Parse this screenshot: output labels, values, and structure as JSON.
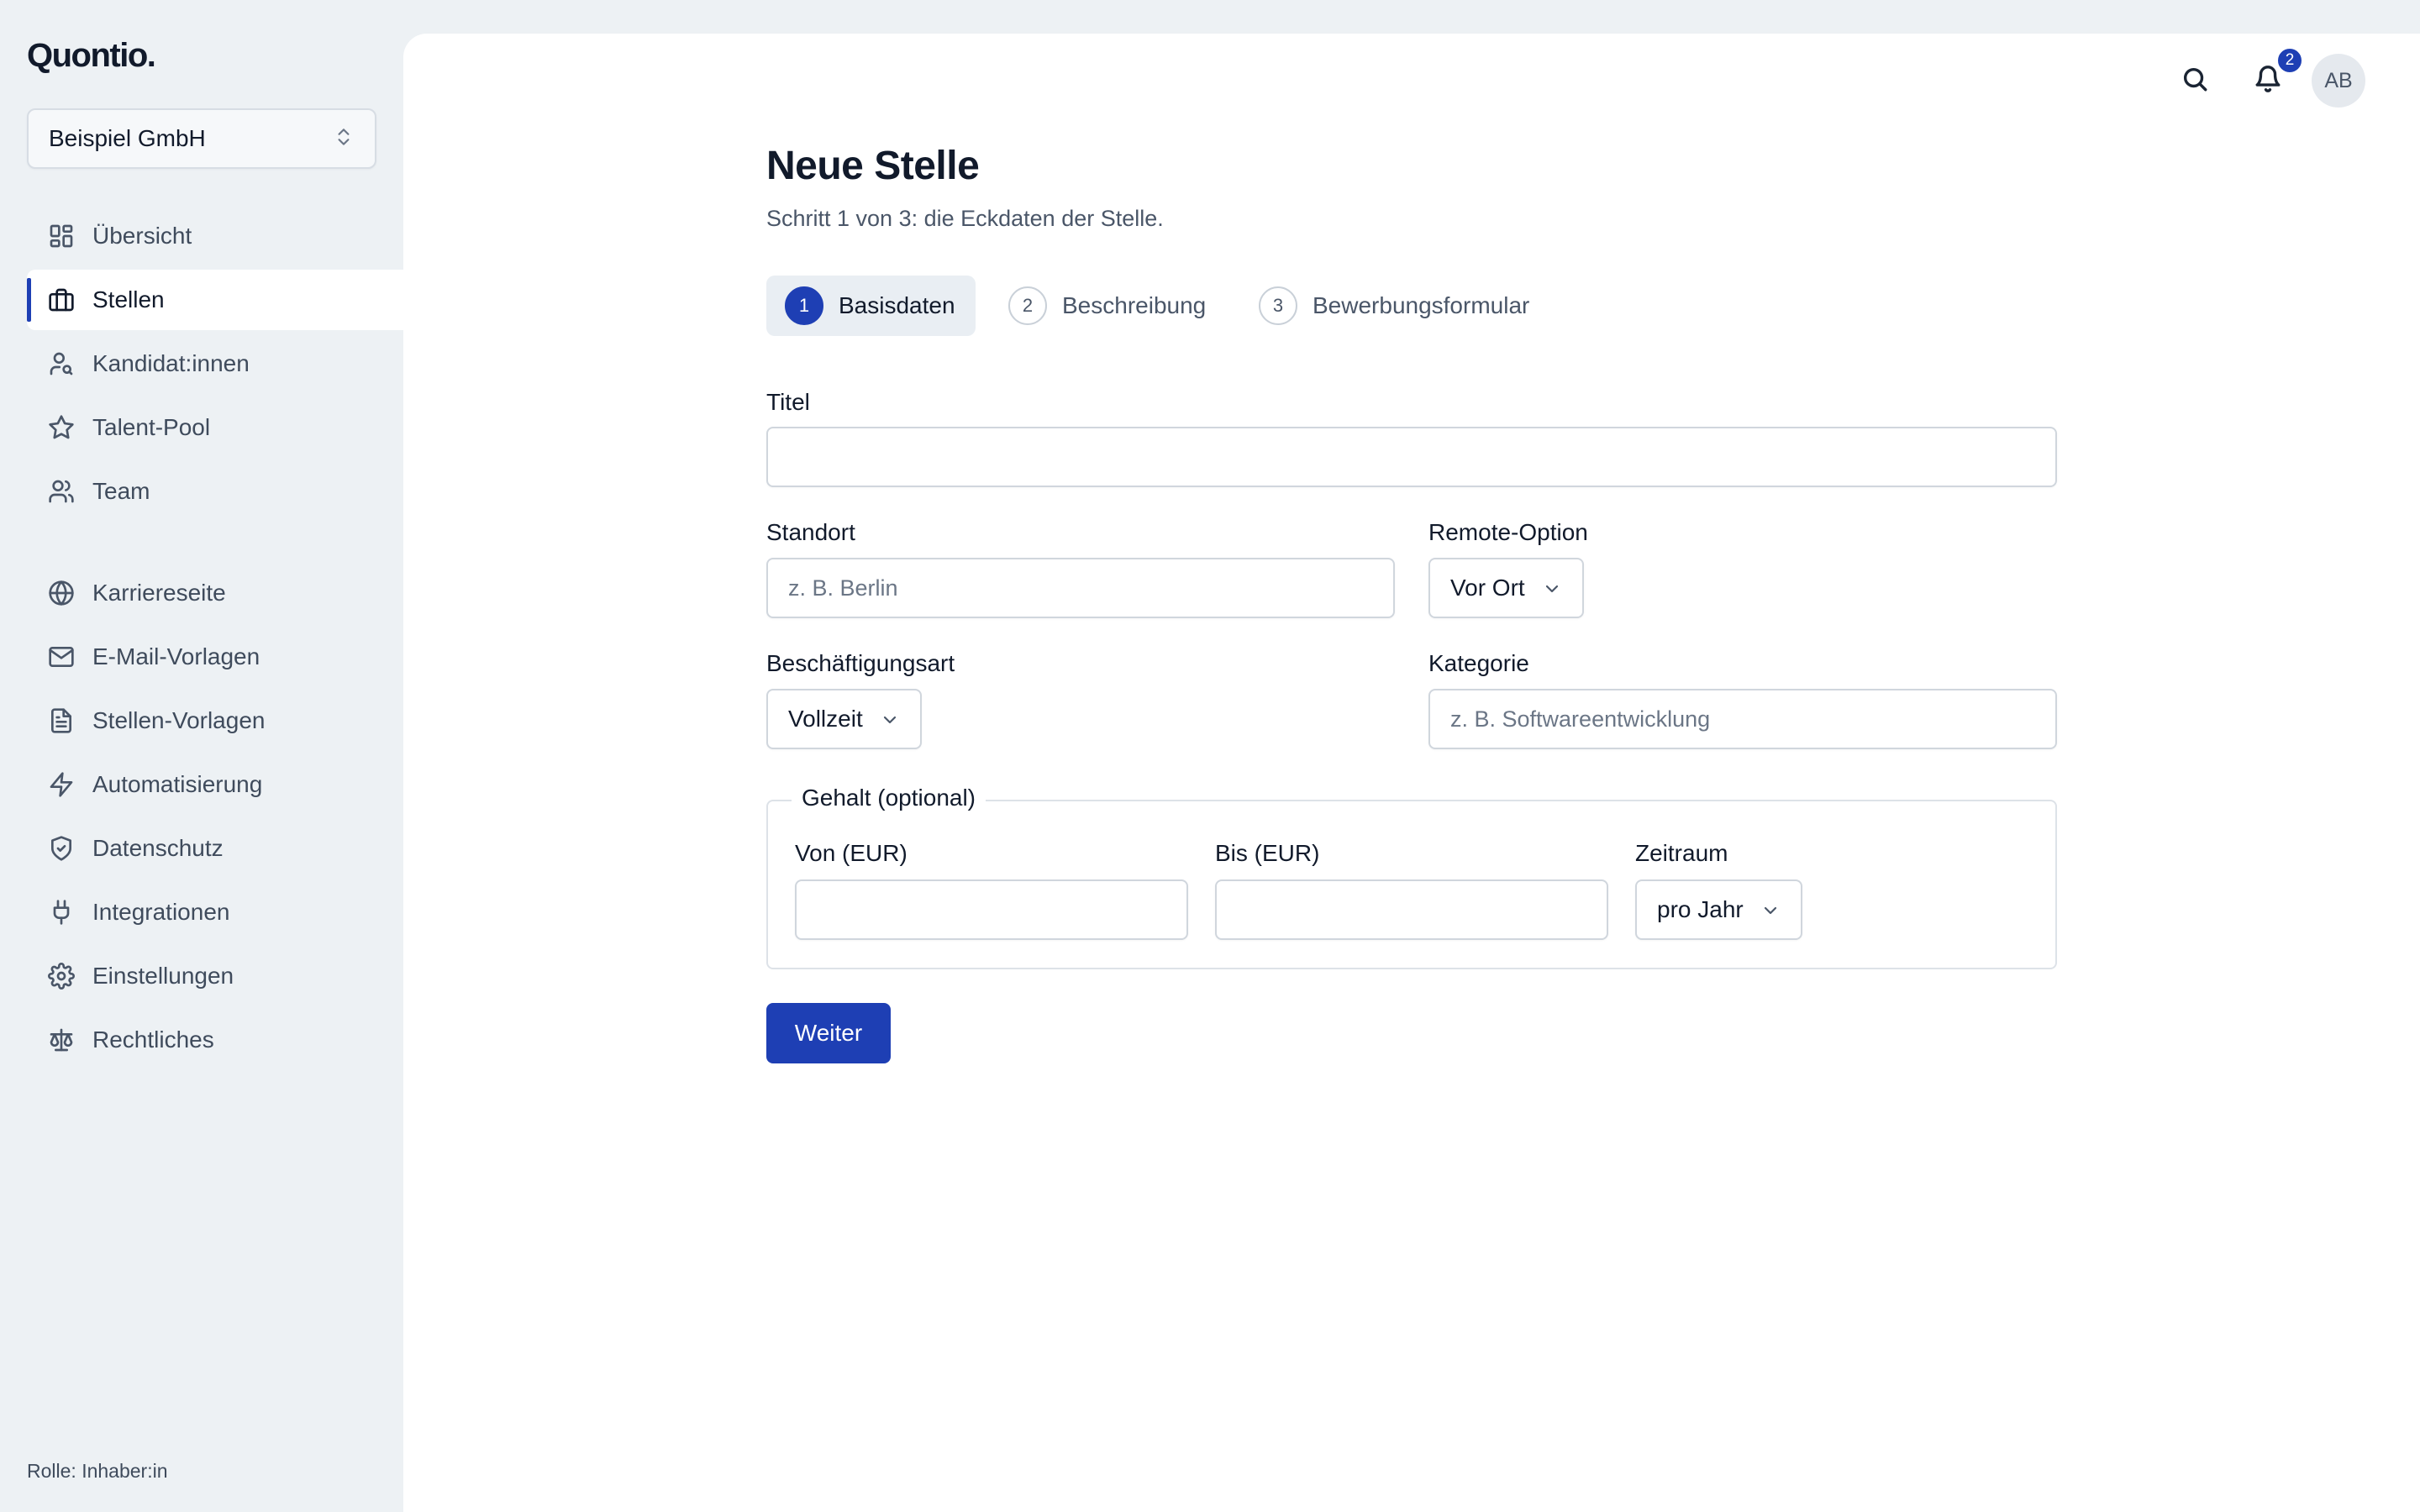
{
  "app": {
    "logo": "Quontio."
  },
  "org_switcher": {
    "name": "Beispiel GmbH"
  },
  "sidebar": {
    "items": [
      {
        "label": "Übersicht",
        "icon": "dashboard-icon"
      },
      {
        "label": "Stellen",
        "icon": "briefcase-icon",
        "active": true
      },
      {
        "label": "Kandidat:innen",
        "icon": "user-search-icon"
      },
      {
        "label": "Talent-Pool",
        "icon": "star-icon"
      },
      {
        "label": "Team",
        "icon": "users-icon"
      },
      {
        "label": "Karriereseite",
        "icon": "globe-icon"
      },
      {
        "label": "E-Mail-Vorlagen",
        "icon": "mail-icon"
      },
      {
        "label": "Stellen-Vorlagen",
        "icon": "document-icon"
      },
      {
        "label": "Automatisierung",
        "icon": "lightning-icon"
      },
      {
        "label": "Datenschutz",
        "icon": "shield-check-icon"
      },
      {
        "label": "Integrationen",
        "icon": "plug-icon"
      },
      {
        "label": "Einstellungen",
        "icon": "gear-icon"
      },
      {
        "label": "Rechtliches",
        "icon": "scale-icon"
      }
    ],
    "role": "Rolle: Inhaber:in"
  },
  "topbar": {
    "notifications_count": "2",
    "avatar_initials": "AB"
  },
  "page": {
    "title": "Neue Stelle",
    "subtitle": "Schritt 1 von 3: die Eckdaten der Stelle."
  },
  "steps": [
    {
      "num": "1",
      "label": "Basisdaten",
      "active": true
    },
    {
      "num": "2",
      "label": "Beschreibung"
    },
    {
      "num": "3",
      "label": "Bewerbungsformular"
    }
  ],
  "form": {
    "title_label": "Titel",
    "title_value": "",
    "location_label": "Standort",
    "location_placeholder": "z. B. Berlin",
    "remote_label": "Remote-Option",
    "remote_value": "Vor Ort",
    "employment_label": "Beschäftigungsart",
    "employment_value": "Vollzeit",
    "category_label": "Kategorie",
    "category_placeholder": "z. B. Softwareentwicklung",
    "salary_legend": "Gehalt (optional)",
    "salary_from_label": "Von (EUR)",
    "salary_to_label": "Bis (EUR)",
    "period_label": "Zeitraum",
    "period_value": "pro Jahr",
    "submit_label": "Weiter"
  },
  "colors": {
    "accent": "#1e3fb4",
    "sidebar_bg": "#edf1f4",
    "surface": "#ffffff"
  }
}
